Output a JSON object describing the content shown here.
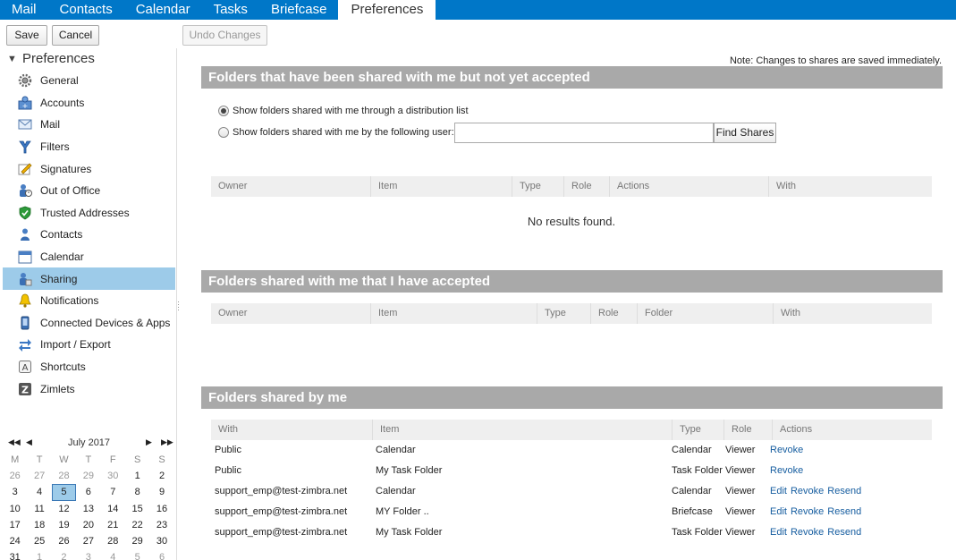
{
  "app_tabs": [
    {
      "label": "Mail"
    },
    {
      "label": "Contacts"
    },
    {
      "label": "Calendar"
    },
    {
      "label": "Tasks"
    },
    {
      "label": "Briefcase"
    },
    {
      "label": "Preferences",
      "active": true
    }
  ],
  "toolbar": {
    "save_label": "Save",
    "cancel_label": "Cancel",
    "undo_label": "Undo Changes"
  },
  "sidebar": {
    "header": "Preferences",
    "items": [
      {
        "label": "General",
        "icon": "gear-icon"
      },
      {
        "label": "Accounts",
        "icon": "accounts-icon"
      },
      {
        "label": "Mail",
        "icon": "envelope-icon"
      },
      {
        "label": "Filters",
        "icon": "filter-icon"
      },
      {
        "label": "Signatures",
        "icon": "signature-icon"
      },
      {
        "label": "Out of Office",
        "icon": "out-of-office-icon"
      },
      {
        "label": "Trusted Addresses",
        "icon": "shield-check-icon"
      },
      {
        "label": "Contacts",
        "icon": "contact-person-icon"
      },
      {
        "label": "Calendar",
        "icon": "calendar-icon"
      },
      {
        "label": "Sharing",
        "icon": "sharing-icon",
        "selected": true
      },
      {
        "label": "Notifications",
        "icon": "bell-icon"
      },
      {
        "label": "Connected Devices & Apps",
        "icon": "mobile-device-icon"
      },
      {
        "label": "Import / Export",
        "icon": "import-export-icon"
      },
      {
        "label": "Shortcuts",
        "icon": "keyboard-shortcut-icon"
      },
      {
        "label": "Zimlets",
        "icon": "zimlet-icon"
      }
    ]
  },
  "mini_calendar": {
    "title": "July 2017",
    "weekdays": [
      "M",
      "T",
      "W",
      "T",
      "F",
      "S",
      "S"
    ],
    "weeks": [
      [
        "26",
        "27",
        "28",
        "29",
        "30",
        "1",
        "2"
      ],
      [
        "3",
        "4",
        "5",
        "6",
        "7",
        "8",
        "9"
      ],
      [
        "10",
        "11",
        "12",
        "13",
        "14",
        "15",
        "16"
      ],
      [
        "17",
        "18",
        "19",
        "20",
        "21",
        "22",
        "23"
      ],
      [
        "24",
        "25",
        "26",
        "27",
        "28",
        "29",
        "30"
      ],
      [
        "31",
        "1",
        "2",
        "3",
        "4",
        "5",
        "6"
      ]
    ],
    "today": "5"
  },
  "content": {
    "note": "Note: Changes to shares are saved immediately.",
    "pending": {
      "title": "Folders that have been shared with me but not yet accepted",
      "radio_dl": "Show folders shared with me through a distribution list",
      "radio_user": "Show folders shared with me by the following user:",
      "user_value": "",
      "find_label": "Find Shares",
      "columns": [
        "Owner",
        "Item",
        "Type",
        "Role",
        "Actions",
        "With"
      ],
      "empty_text": "No results found."
    },
    "accepted": {
      "title": "Folders shared with me that I have accepted",
      "columns": [
        "Owner",
        "Item",
        "Type",
        "Role",
        "Folder",
        "With"
      ]
    },
    "by_me": {
      "title": "Folders shared by me",
      "columns": [
        "With",
        "Item",
        "Type",
        "Role",
        "Actions"
      ],
      "rows": [
        {
          "with": "Public",
          "item": "Calendar",
          "type": "Calendar",
          "role": "Viewer",
          "actions": [
            "Revoke"
          ]
        },
        {
          "with": "Public",
          "item": "My Task Folder",
          "type": "Task Folder",
          "role": "Viewer",
          "actions": [
            "Revoke"
          ]
        },
        {
          "with": "support_emp@test-zimbra.net",
          "item": "Calendar",
          "type": "Calendar",
          "role": "Viewer",
          "actions": [
            "Edit",
            "Revoke",
            "Resend"
          ]
        },
        {
          "with": "support_emp@test-zimbra.net",
          "item": "MY Folder ..",
          "type": "Briefcase",
          "role": "Viewer",
          "actions": [
            "Edit",
            "Revoke",
            "Resend"
          ]
        },
        {
          "with": "support_emp@test-zimbra.net",
          "item": "My Task Folder",
          "type": "Task Folder",
          "role": "Viewer",
          "actions": [
            "Edit",
            "Revoke",
            "Resend"
          ]
        }
      ]
    }
  }
}
